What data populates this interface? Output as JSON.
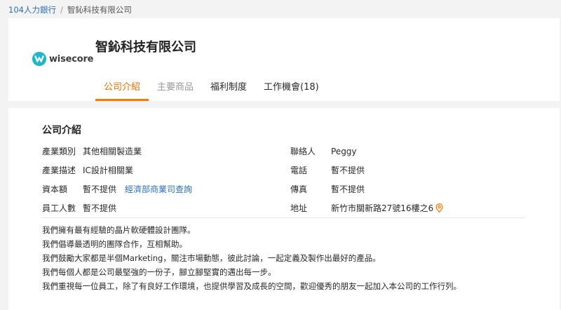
{
  "breadcrumb": {
    "home": "104人力銀行",
    "separator": "/",
    "current": "智鈊科技有限公司"
  },
  "company": {
    "logo_text": "wisecore",
    "name": "智鈊科技有限公司"
  },
  "tabs": [
    {
      "label": "公司介紹",
      "state": "active"
    },
    {
      "label": "主要商品",
      "state": "muted"
    },
    {
      "label": "福利制度",
      "state": "normal"
    },
    {
      "label": "工作機會(18)",
      "state": "normal"
    }
  ],
  "intro": {
    "title": "公司介紹",
    "left": [
      {
        "label": "產業類別",
        "value": "其他相關製造業"
      },
      {
        "label": "產業描述",
        "value": "IC設計相關業"
      },
      {
        "label": "資本額",
        "value": "暫不提供",
        "link": "經濟部商業司查詢"
      },
      {
        "label": "員工人數",
        "value": "暫不提供"
      }
    ],
    "right": [
      {
        "label": "聯絡人",
        "value": "Peggy"
      },
      {
        "label": "電話",
        "value": "暫不提供"
      },
      {
        "label": "傳真",
        "value": "暫不提供"
      },
      {
        "label": "地址",
        "value": "新竹市關新路27號16樓之6"
      }
    ],
    "description": [
      "我們擁有最有經驗的晶片軟硬體設計團隊。",
      "我們倡導最透明的團隊合作，互相幫助。",
      "我們鼓勵大家都是半個Marketing，關注市場動態，彼此討論，一起定義及製作出最好的產品。",
      "我們每個人都是公司最堅強的一份子，腳立腳堅實的邁出每一步。",
      "我們重視每一位員工，除了有良好工作環境，也提供學習及成長的空間，歡迎優秀的朋友一起加入本公司的工作行列。"
    ]
  },
  "colors": {
    "accent": "#ff7800",
    "link": "#2f6fb5",
    "logo_teal": "#20b5c8",
    "pin": "#ff7800"
  },
  "icons": {
    "logo": "wisecore-logo-icon",
    "address": "map-pin-icon"
  }
}
